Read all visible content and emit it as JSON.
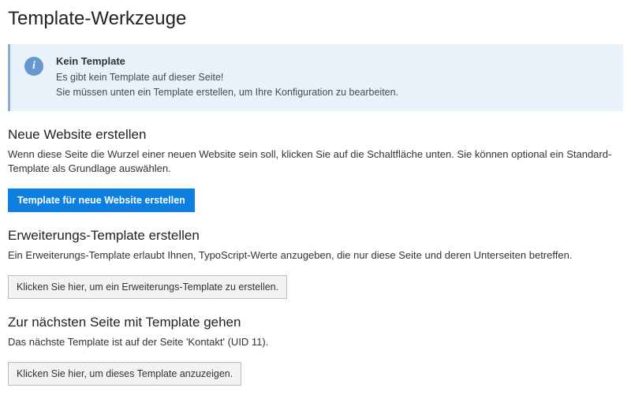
{
  "page_title": "Template-Werkzeuge",
  "callout": {
    "title": "Kein Template",
    "line1": "Es gibt kein Template auf dieser Seite!",
    "line2": "Sie müssen unten ein Template erstellen, um Ihre Konfiguration zu bearbeiten."
  },
  "section_new": {
    "heading": "Neue Website erstellen",
    "text": "Wenn diese Seite die Wurzel einer neuen Website sein soll, klicken Sie auf die Schaltfläche unten. Sie können optional ein Standard-Template als Grundlage auswählen.",
    "button": "Template für neue Website erstellen"
  },
  "section_ext": {
    "heading": "Erweiterungs-Template erstellen",
    "text": "Ein Erweiterungs-Template erlaubt Ihnen, TypoScript-Werte anzugeben, die nur diese Seite und deren Unterseiten betreffen.",
    "button": "Klicken Sie hier, um ein Erweiterungs-Template zu erstellen."
  },
  "section_goto": {
    "heading": "Zur nächsten Seite mit Template gehen",
    "text": "Das nächste Template ist auf der Seite 'Kontakt' (UID 11).",
    "button": "Klicken Sie hier, um dieses Template anzuzeigen."
  }
}
